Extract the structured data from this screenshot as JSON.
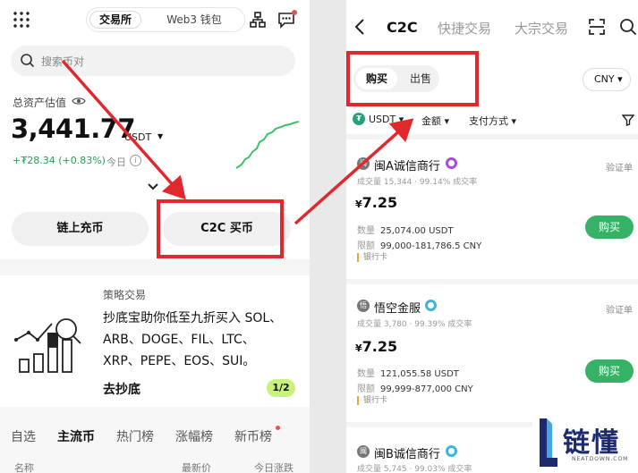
{
  "left": {
    "segment": {
      "exchange": "交易所",
      "web3": "Web3 钱包"
    },
    "search_placeholder": "搜索币对",
    "asset": {
      "label": "总资产估值",
      "value": "3,441.77",
      "unit": "USDT",
      "change": "+₮28.34 (+0.83%)",
      "today": "今日",
      "info": "i"
    },
    "buttons": {
      "deposit": "链上充币",
      "c2c": "C2C 买币"
    },
    "strategy": {
      "title": "策略交易",
      "line1": "抄底宝助你低至九折买入 SOL、",
      "line2": "ARB、DOGE、FIL、LTC、",
      "line3": "XRP、PEPE、EOS、SUI。",
      "link": "去抄底",
      "pager": "1/2"
    },
    "market_tabs": [
      "自选",
      "主流币",
      "热门榜",
      "涨幅榜",
      "新币榜"
    ],
    "columns": {
      "name": "名称",
      "latest": "最新价",
      "today_change": "今日涨跌"
    }
  },
  "right": {
    "tabs": [
      "C2C",
      "快捷交易",
      "大宗交易"
    ],
    "side": {
      "buy": "购买",
      "sell": "出售"
    },
    "currency": "CNY",
    "filters": {
      "coin": "USDT",
      "coin_icon": "₮",
      "amount": "金额",
      "payment": "支付方式"
    },
    "merchants": [
      {
        "name": "闽A诚信商行",
        "avatar": "闽",
        "badge_color": "#a84cd9",
        "verify": "验证单",
        "stats": "成交量 15,344 · 99.14% 成交率",
        "price_symbol": "¥",
        "price": "7.25",
        "qty_label": "数量",
        "qty": "25,074.00 USDT",
        "limit_label": "限额",
        "limit": "99,000-181,786.5 CNY",
        "payment": "银行卡",
        "action": "购买"
      },
      {
        "name": "悟空金服",
        "avatar": "悟",
        "badge_color": "#3fb6d8",
        "verify": "验证单",
        "stats": "成交量 3,780 · 99.39% 成交率",
        "price_symbol": "¥",
        "price": "7.25",
        "qty_label": "数量",
        "qty": "121,055.58 USDT",
        "limit_label": "限额",
        "limit": "99,999-877,000 CNY",
        "payment": "银行卡",
        "action": "购买"
      },
      {
        "name": "闽B诚信商行",
        "avatar": "闽",
        "badge_color": "#3fb6d8",
        "stats": "成交量 5,745 · 99.03% 成交率"
      }
    ]
  },
  "watermark": {
    "cn": "链懂",
    "en": "NEATDOWN.COM"
  },
  "colors": {
    "highlight": "#e0282d",
    "buy_green": "#36b266",
    "up_green": "#2c9a55",
    "pager_lime": "#c8f27a"
  }
}
